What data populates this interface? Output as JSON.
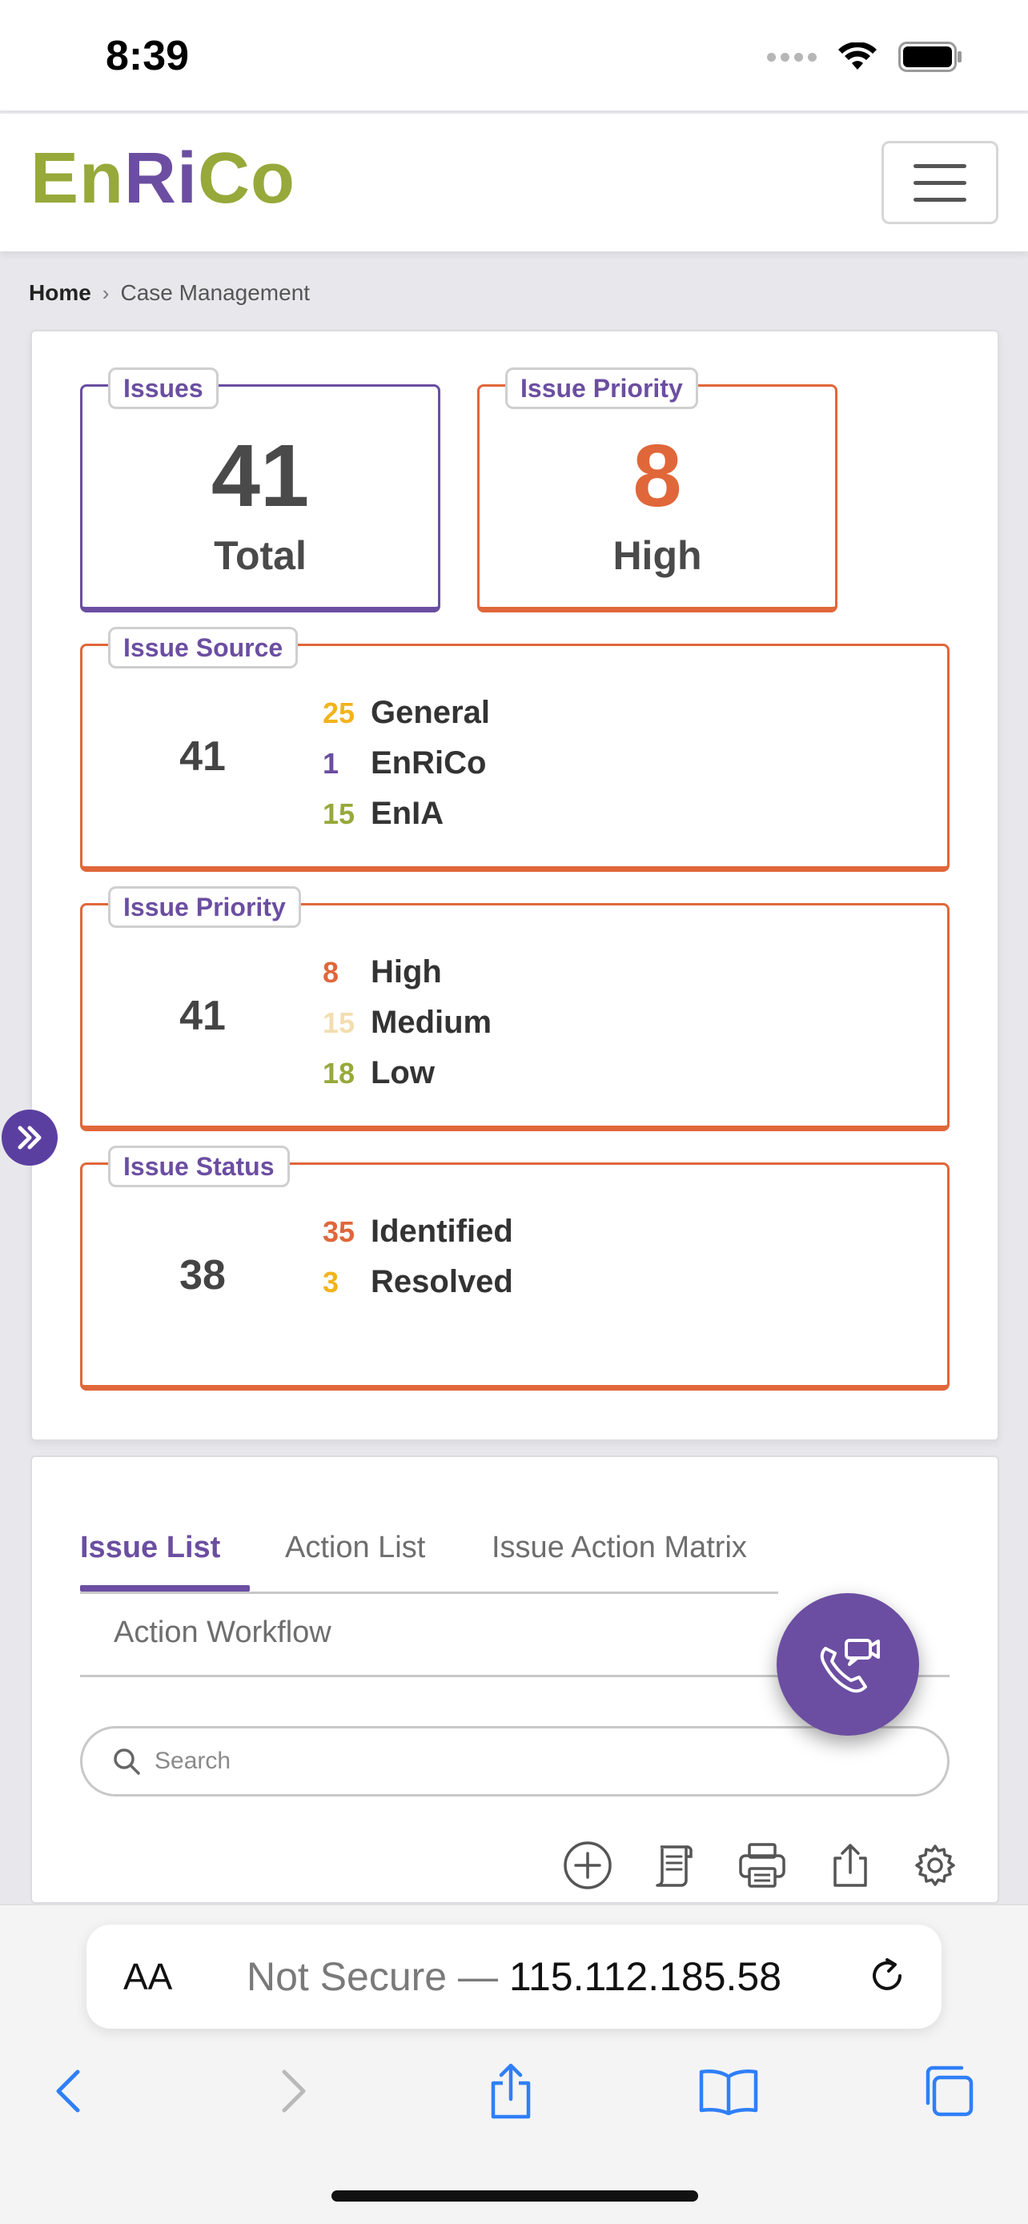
{
  "status_bar": {
    "time": "8:39"
  },
  "header": {
    "logo": {
      "part1": "En",
      "part2": "Ri",
      "part3": "Co"
    }
  },
  "breadcrumb": {
    "home": "Home",
    "current": "Case Management"
  },
  "summary": {
    "issues": {
      "tag": "Issues",
      "value": "41",
      "label": "Total"
    },
    "issue_priority_high": {
      "tag": "Issue Priority",
      "value": "8",
      "label": "High"
    },
    "issue_source": {
      "tag": "Issue Source",
      "total": "41",
      "items": [
        {
          "count": "25",
          "label": "General",
          "color": "#f2b41c"
        },
        {
          "count": "1",
          "label": "EnRiCo",
          "color": "#6b4ea1"
        },
        {
          "count": "15",
          "label": "EnIA",
          "color": "#97a93a"
        }
      ]
    },
    "issue_priority": {
      "tag": "Issue Priority",
      "total": "41",
      "items": [
        {
          "count": "8",
          "label": "High",
          "color": "#e0673a"
        },
        {
          "count": "15",
          "label": "Medium",
          "color": "#f3deb0"
        },
        {
          "count": "18",
          "label": "Low",
          "color": "#97a93a"
        }
      ]
    },
    "issue_status": {
      "tag": "Issue Status",
      "total": "38",
      "items": [
        {
          "count": "35",
          "label": "Identified",
          "color": "#e0673a"
        },
        {
          "count": "3",
          "label": "Resolved",
          "color": "#f2b41c"
        }
      ]
    }
  },
  "tabs": {
    "items": [
      {
        "label": "Issue List",
        "active": true
      },
      {
        "label": "Action List",
        "active": false
      },
      {
        "label": "Issue Action Matrix",
        "active": false
      },
      {
        "label": "Action Workflow",
        "active": false
      }
    ]
  },
  "search": {
    "placeholder": "Search",
    "value": ""
  },
  "toolbar": {
    "icons": [
      "add-circle-icon",
      "document-icon",
      "print-icon",
      "export-icon",
      "settings-icon"
    ]
  },
  "fab": {
    "icon": "video-call-icon"
  },
  "browser": {
    "aa_label": "AA",
    "not_secure": "Not Secure —",
    "host": "115.112.185.58"
  },
  "colors": {
    "brand_purple": "#6b4ea1",
    "brand_green": "#97a93a",
    "accent_orange": "#e0673a",
    "accent_yellow": "#f2b41c"
  }
}
